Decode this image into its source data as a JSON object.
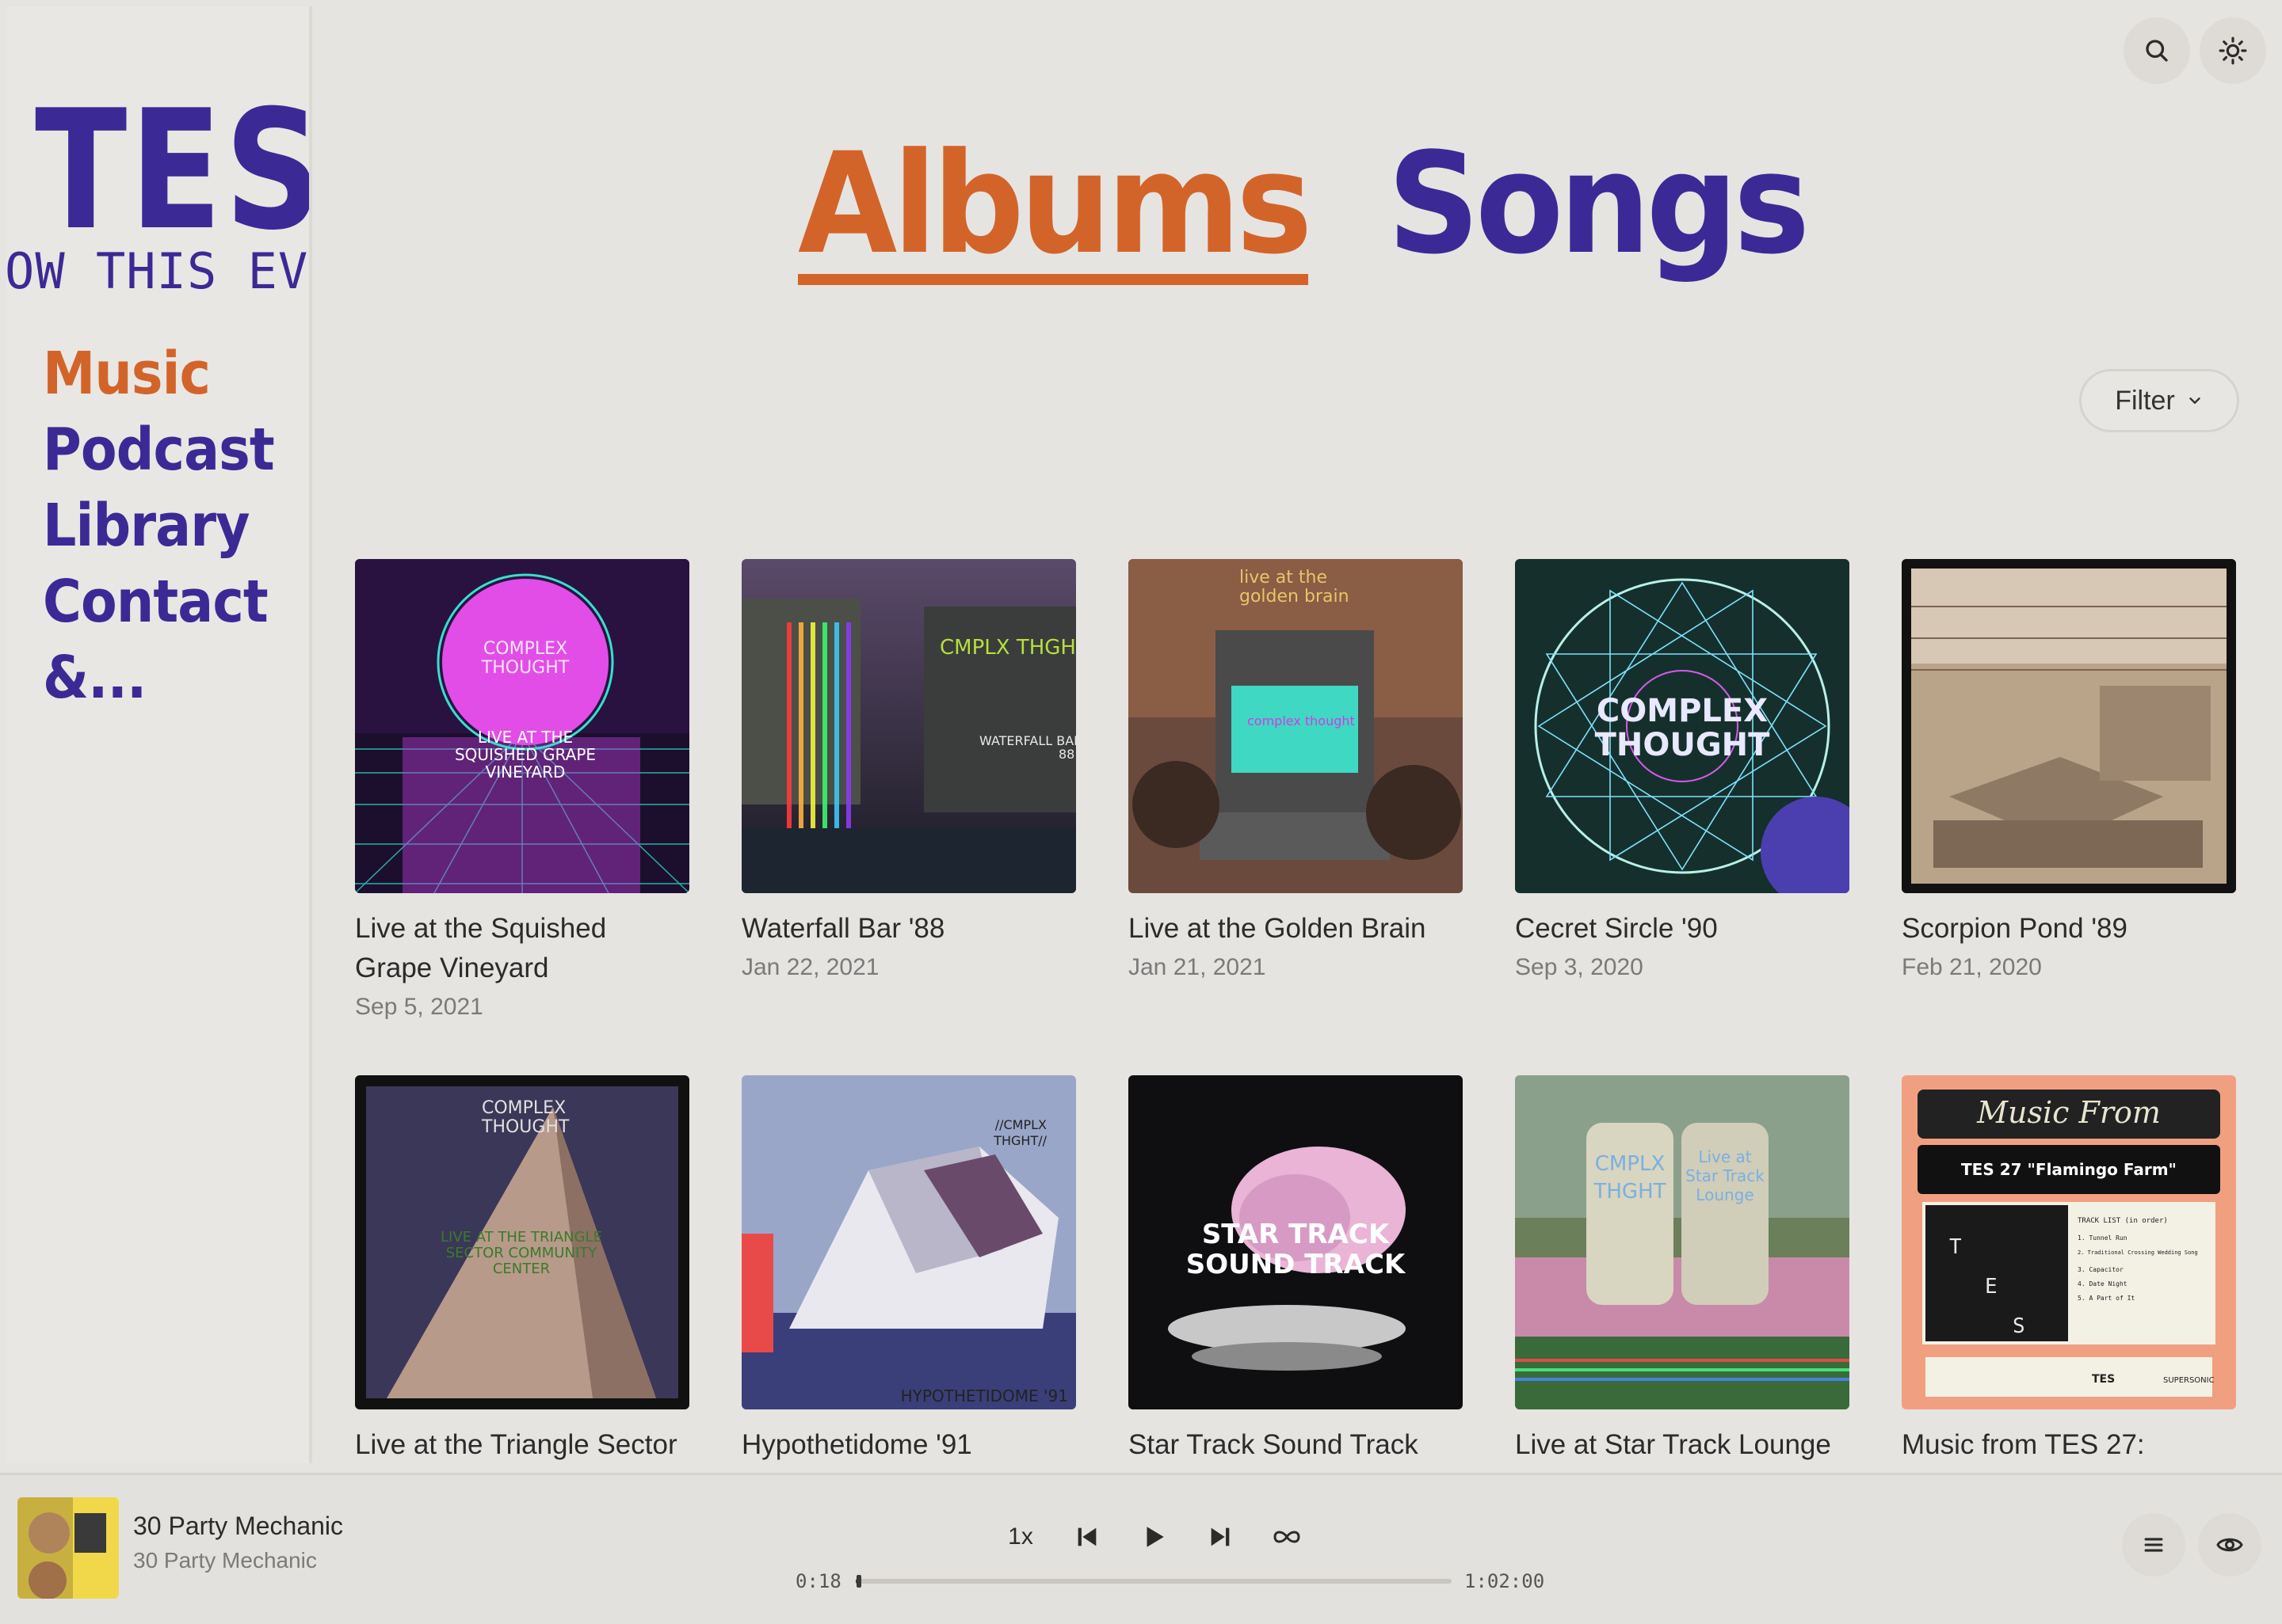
{
  "sidebar": {
    "logo": "TES",
    "marquee": "OW THIS EVE",
    "nav": [
      "Music",
      "Podcast",
      "Library",
      "Contact",
      "&..."
    ],
    "active": "Music"
  },
  "header": {
    "tabs": [
      "Albums",
      "Songs"
    ],
    "active_tab": "Albums",
    "search_icon": "search-icon",
    "theme_icon": "sun-icon"
  },
  "filter": {
    "label": "Filter"
  },
  "albums": [
    {
      "title": "Live at the Squished Grape Vineyard",
      "date": "Sep 5, 2021",
      "cover_text": [
        "COMPLEX",
        "THOUGHT",
        "LIVE AT THE",
        "SQUISHED GRAPE",
        "VINEYARD"
      ]
    },
    {
      "title": "Waterfall Bar '88",
      "date": "Jan 22, 2021",
      "cover_text": [
        "CMPLX THGHT",
        "WATERFALL BAR",
        "88"
      ]
    },
    {
      "title": "Live at the Golden Brain",
      "date": "Jan 21, 2021",
      "cover_text": [
        "live at the",
        "golden brain",
        "complex thought"
      ]
    },
    {
      "title": "Cecret Sircle '90",
      "date": "Sep 3, 2020",
      "cover_text": [
        "COMPLEX",
        "THOUGHT"
      ]
    },
    {
      "title": "Scorpion Pond '89",
      "date": "Feb 21, 2020",
      "cover_text": []
    },
    {
      "title": "Live at the Triangle Sector",
      "date": "",
      "cover_text": [
        "COMPLEX",
        "THOUGHT",
        "LIVE AT THE TRIANGLE",
        "SECTOR COMMUNITY",
        "CENTER"
      ]
    },
    {
      "title": "Hypothetidome '91",
      "date": "",
      "cover_text": [
        "//CMPLX",
        "THGHT//",
        "HYPOTHETIDOME '91"
      ]
    },
    {
      "title": "Star Track Sound Track",
      "date": "",
      "cover_text": [
        "STAR TRACK",
        "SOUND TRACK"
      ]
    },
    {
      "title": "Live at Star Track Lounge",
      "date": "",
      "cover_text": [
        "CMPLX",
        "THGHT",
        "Live at",
        "Star Track",
        "Lounge"
      ]
    },
    {
      "title": "Music from TES 27:",
      "date": "",
      "cover_text": [
        "Music From",
        "TES 27 \"Flamingo Farm\"",
        "T",
        "E",
        "S",
        "TRACK LIST (in order)",
        "1. Tunnel Run",
        "2. Traditional Crossing Wedding Song",
        "3. Capacitor",
        "4. Date Night",
        "5. A Part of It",
        "TES",
        "SUPERSONIC"
      ]
    }
  ],
  "player": {
    "title": "30 Party Mechanic",
    "artist": "30 Party Mechanic",
    "speed": "1x",
    "elapsed": "0:18",
    "duration": "1:02:00",
    "progress": 0.005
  },
  "colors": {
    "accent_orange": "#d2642a",
    "accent_purple": "#3b2a95",
    "background": "#e6e4e1"
  }
}
